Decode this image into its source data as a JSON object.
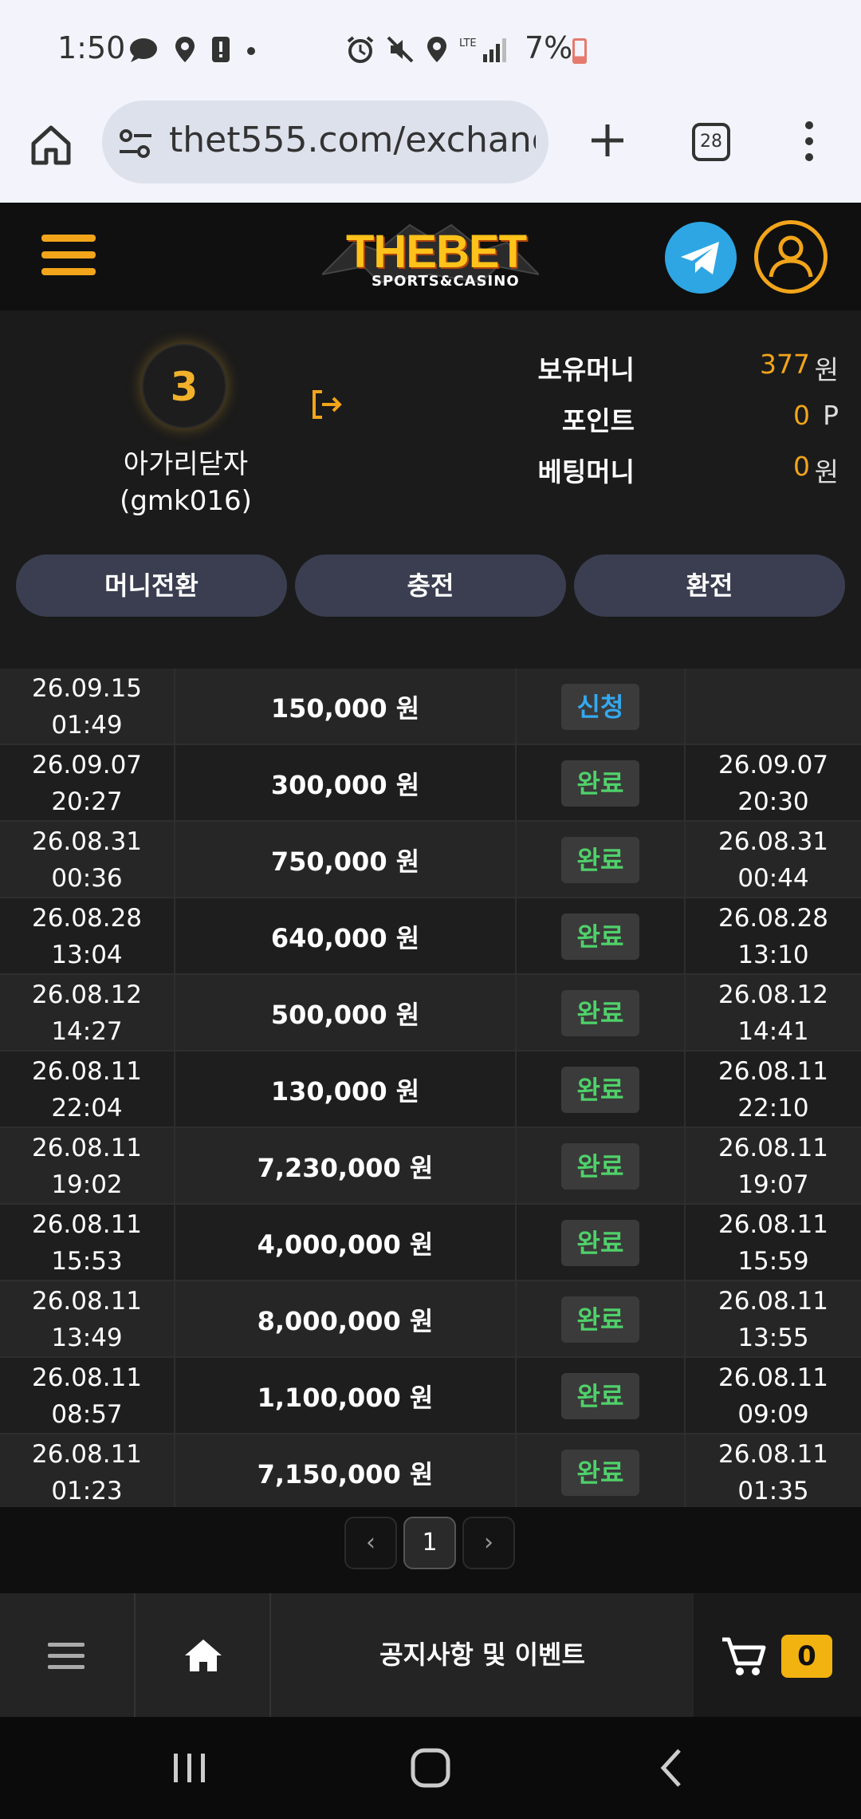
{
  "status_bar": {
    "time": "1:50",
    "battery_pct": "7%"
  },
  "browser": {
    "url": "thet555.com/exchange",
    "tab_count": "28"
  },
  "header": {
    "logo_main": "THEBET",
    "logo_sub": "SPORTS&CASINO"
  },
  "account": {
    "level": "3",
    "nickname": "아가리닫자",
    "user_id": "(gmk016)",
    "balance_label": "보유머니",
    "balance_value": "377",
    "balance_unit": "원",
    "points_label": "포인트",
    "points_value": "0",
    "points_unit": "P",
    "betting_label": "베팅머니",
    "betting_value": "0",
    "betting_unit": "원"
  },
  "tabs": [
    {
      "label": "머니전환"
    },
    {
      "label": "충전"
    },
    {
      "label": "환전"
    }
  ],
  "rows": [
    {
      "req_date": "26.09.15",
      "req_time": "01:49",
      "amount": "150,000 원",
      "status": "신청",
      "status_kind": "req",
      "done_date": "",
      "done_time": ""
    },
    {
      "req_date": "26.09.07",
      "req_time": "20:27",
      "amount": "300,000 원",
      "status": "완료",
      "status_kind": "done",
      "done_date": "26.09.07",
      "done_time": "20:30"
    },
    {
      "req_date": "26.08.31",
      "req_time": "00:36",
      "amount": "750,000 원",
      "status": "완료",
      "status_kind": "done",
      "done_date": "26.08.31",
      "done_time": "00:44"
    },
    {
      "req_date": "26.08.28",
      "req_time": "13:04",
      "amount": "640,000 원",
      "status": "완료",
      "status_kind": "done",
      "done_date": "26.08.28",
      "done_time": "13:10"
    },
    {
      "req_date": "26.08.12",
      "req_time": "14:27",
      "amount": "500,000 원",
      "status": "완료",
      "status_kind": "done",
      "done_date": "26.08.12",
      "done_time": "14:41"
    },
    {
      "req_date": "26.08.11",
      "req_time": "22:04",
      "amount": "130,000 원",
      "status": "완료",
      "status_kind": "done",
      "done_date": "26.08.11",
      "done_time": "22:10"
    },
    {
      "req_date": "26.08.11",
      "req_time": "19:02",
      "amount": "7,230,000 원",
      "status": "완료",
      "status_kind": "done",
      "done_date": "26.08.11",
      "done_time": "19:07"
    },
    {
      "req_date": "26.08.11",
      "req_time": "15:53",
      "amount": "4,000,000 원",
      "status": "완료",
      "status_kind": "done",
      "done_date": "26.08.11",
      "done_time": "15:59"
    },
    {
      "req_date": "26.08.11",
      "req_time": "13:49",
      "amount": "8,000,000 원",
      "status": "완료",
      "status_kind": "done",
      "done_date": "26.08.11",
      "done_time": "13:55"
    },
    {
      "req_date": "26.08.11",
      "req_time": "08:57",
      "amount": "1,100,000 원",
      "status": "완료",
      "status_kind": "done",
      "done_date": "26.08.11",
      "done_time": "09:09"
    },
    {
      "req_date": "26.08.11",
      "req_time": "01:23",
      "amount": "7,150,000 원",
      "status": "완료",
      "status_kind": "done",
      "done_date": "26.08.11",
      "done_time": "01:35"
    }
  ],
  "pagination": {
    "prev": "‹",
    "current": "1",
    "next": "›"
  },
  "bottom_bar": {
    "notice_label": "공지사항 및 이벤트",
    "cart_count": "0"
  },
  "colors": {
    "accent": "#f2a51a",
    "done": "#4fd16a",
    "request": "#34a9f0",
    "tab_bg": "#3a3e50"
  }
}
